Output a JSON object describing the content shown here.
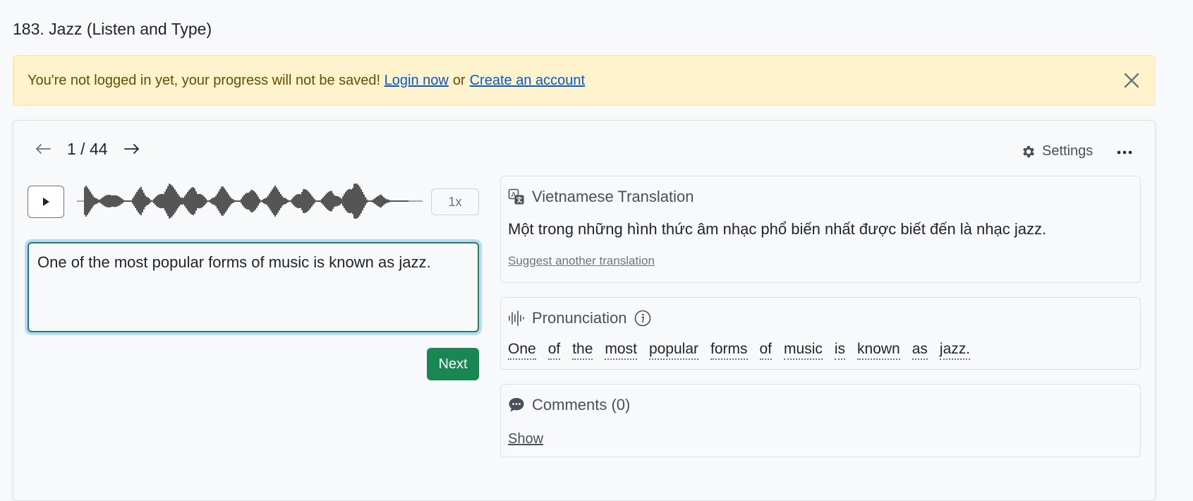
{
  "page": {
    "title": "183. Jazz (Listen and Type)"
  },
  "alert": {
    "message": "You're not logged in yet, your progress will not be saved!",
    "login_link": "Login now",
    "separator": "or",
    "signup_link": "Create an account"
  },
  "nav": {
    "counter": "1 / 44"
  },
  "toolbar": {
    "settings_label": "Settings"
  },
  "player": {
    "speed": "1x"
  },
  "answer": {
    "value": "One of the most popular forms of music is known as jazz."
  },
  "next_label": "Next",
  "translation": {
    "heading": "Vietnamese Translation",
    "text": "Một trong những hình thức âm nhạc phổ biến nhất được biết đến là nhạc jazz.",
    "suggest_link": "Suggest another translation"
  },
  "pronunciation": {
    "heading": "Pronunciation",
    "words": [
      "One",
      "of",
      "the",
      "most",
      "popular",
      "forms",
      "of",
      "music",
      "is",
      "known",
      "as",
      "jazz."
    ]
  },
  "comments": {
    "heading": "Comments (0)",
    "show_link": "Show"
  }
}
